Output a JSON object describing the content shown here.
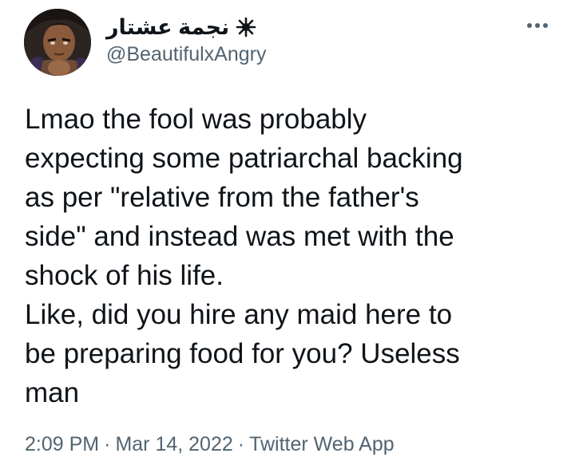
{
  "author": {
    "display_name": "نجمة عشتار",
    "name_icon": "eight-pointed-star-icon",
    "handle": "@BeautifulxAngry",
    "avatar": "avatar"
  },
  "tweet": {
    "lines": [
      "Lmao the fool was probably",
      "expecting some patriarchal backing",
      "as per \"relative from the father's",
      "side\" and instead was met with the",
      "shock of his life.",
      "Like, did you hire any maid here to",
      "be preparing food for you? Useless",
      "man"
    ],
    "time": "2:09 PM",
    "date": "Mar 14, 2022",
    "separator": "·",
    "source": "Twitter Web App"
  },
  "menu": {
    "icon": "more-options-icon"
  },
  "colors": {
    "text": "#0f1419",
    "secondary": "#536471",
    "background": "#ffffff"
  }
}
